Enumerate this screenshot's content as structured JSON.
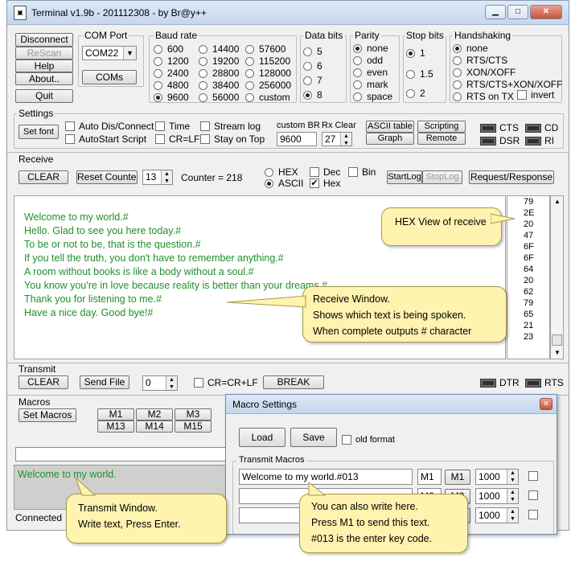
{
  "window": {
    "title": "Terminal v1.9b - 201112308 - by Br@y++",
    "app_icon": "terminal-icon"
  },
  "titlebar_buttons": {
    "minimize": "▁",
    "maximize": "□",
    "close": "✕"
  },
  "top_buttons": {
    "disconnect": "Disconnect",
    "rescan": "ReScan",
    "help": "Help",
    "about": "About..",
    "quit": "Quit"
  },
  "com_port": {
    "label": "COM Port",
    "value": "COM22",
    "coms_button": "COMs"
  },
  "baud": {
    "label": "Baud rate",
    "options": [
      "600",
      "1200",
      "2400",
      "4800",
      "9600",
      "14400",
      "19200",
      "28800",
      "38400",
      "56000",
      "57600",
      "115200",
      "128000",
      "256000",
      "custom"
    ],
    "selected": "9600"
  },
  "databits": {
    "label": "Data bits",
    "options": [
      "5",
      "6",
      "7",
      "8"
    ],
    "selected": "8"
  },
  "parity": {
    "label": "Parity",
    "options": [
      "none",
      "odd",
      "even",
      "mark",
      "space"
    ],
    "selected": "none"
  },
  "stopbits": {
    "label": "Stop bits",
    "options": [
      "1",
      "1.5",
      "2"
    ],
    "selected": "1"
  },
  "handshaking": {
    "label": "Handshaking",
    "options": [
      "none",
      "RTS/CTS",
      "XON/XOFF",
      "RTS/CTS+XON/XOFF",
      "RTS on TX"
    ],
    "selected": "none",
    "invert": "invert"
  },
  "settings": {
    "label": "Settings",
    "set_font": "Set font",
    "auto_dis_connect": "Auto Dis/Connect",
    "autostart_script": "AutoStart Script",
    "time": "Time",
    "cr_lf": "CR=LF",
    "stream_log": "Stream log",
    "stay_on_top": "Stay on Top",
    "custom_br_label": "custom BR",
    "custom_br_value": "9600",
    "rx_clear_label": "Rx Clear",
    "rx_clear_value": "27",
    "ascii_table": "ASCII table",
    "graph": "Graph",
    "scripting": "Scripting",
    "remote": "Remote",
    "leds": [
      "CTS",
      "CD",
      "DSR",
      "RI"
    ]
  },
  "receive": {
    "label": "Receive",
    "clear": "CLEAR",
    "reset_counter": "Reset Counter",
    "counter_spin": "13",
    "counter_text": "Counter = 218",
    "hex": "HEX",
    "ascii": "ASCII",
    "dec": "Dec",
    "bin": "Bin",
    "hex_check": "Hex",
    "startlog": "StartLog",
    "stoplog": "StopLog",
    "request_response": "Request/Response",
    "lines": [
      "Welcome to my world.#",
      "Hello. Glad to see you here today.#",
      "To be or not to be, that is the question.#",
      "If you tell the truth, you don't have to remember anything.#",
      "A room without books is like a body without a soul.#",
      "You know you're in love because reality is better than your dreams.#",
      "Thank you for listening to me.#",
      "Have a nice day. Good bye!#"
    ],
    "hex_values": [
      "79",
      "2E",
      "20",
      "47",
      "6F",
      "6F",
      "64",
      "20",
      "62",
      "79",
      "65",
      "21",
      "23"
    ],
    "text_color": "#20902a"
  },
  "callouts": {
    "hex_view": "HEX View of receive",
    "receive_window": [
      "Receive Window.",
      "Shows which text is being spoken.",
      "When complete outputs # character"
    ],
    "transmit_window": [
      "Transmit Window.",
      "Write text, Press Enter."
    ],
    "macro_hint": [
      "You can also write here.",
      "Press M1 to send this text.",
      "#013 is the enter key code."
    ]
  },
  "transmit": {
    "label": "Transmit",
    "clear": "CLEAR",
    "send_file": "Send File",
    "spin": "0",
    "cr_crlf": "CR=CR+LF",
    "break": "BREAK",
    "leds": [
      "DTR",
      "RTS"
    ],
    "text": "Welcome to my world."
  },
  "macros": {
    "label": "Macros",
    "set_macros": "Set Macros",
    "buttons_row1": [
      "M1",
      "M2",
      "M3"
    ],
    "buttons_row2": [
      "M13",
      "M14",
      "M15"
    ]
  },
  "status": {
    "connected": "Connected"
  },
  "macro_dialog": {
    "title": "Macro Settings",
    "load": "Load",
    "save": "Save",
    "old_format": "old format",
    "transmit_macros_label": "Transmit Macros",
    "rows": [
      {
        "text": "Welcome to my world.#013",
        "name": "M1",
        "button": "M1",
        "interval": "1000"
      },
      {
        "text": "",
        "name": "M2",
        "button": "M2",
        "interval": "1000"
      },
      {
        "text": "",
        "name": "M3",
        "button": "M3",
        "interval": "1000"
      }
    ]
  }
}
